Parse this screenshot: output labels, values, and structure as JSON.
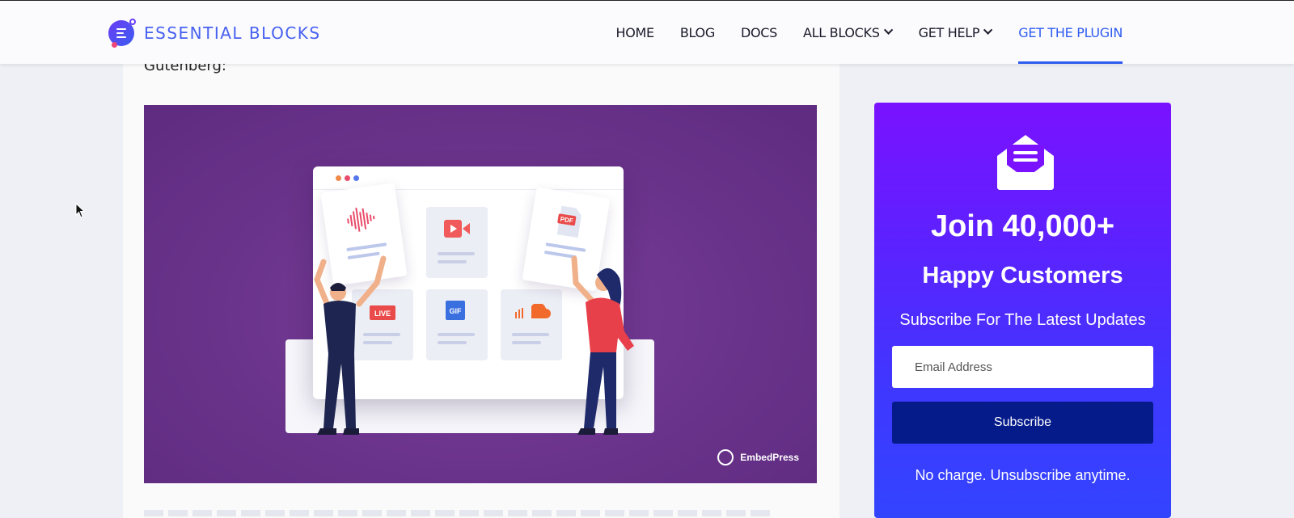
{
  "header": {
    "logo_text": "ESSENTIAL BLOCKS",
    "nav": [
      {
        "label": "HOME"
      },
      {
        "label": "BLOG"
      },
      {
        "label": "DOCS"
      },
      {
        "label": "ALL BLOCKS",
        "dropdown": true
      },
      {
        "label": "GET HELP",
        "dropdown": true
      },
      {
        "label": "GET THE PLUGIN",
        "active": true
      }
    ]
  },
  "article": {
    "intro_text": "Gutenberg:",
    "figure": {
      "tiles": [
        "LIVE",
        "GIF"
      ],
      "pdf_label": "PDF",
      "brand": "EmbedPress"
    }
  },
  "sidebar": {
    "title": "Join 40,000+",
    "subtitle": "Happy Customers",
    "tagline": "Subscribe For The Latest Updates",
    "email_placeholder": "Email Address",
    "subscribe_label": "Subscribe",
    "footnote": "No charge. Unsubscribe anytime."
  },
  "colors": {
    "accent": "#2f5cf0",
    "figure_bg": "#6a338b",
    "sidebar_top": "#7a12ff",
    "sidebar_bottom": "#3344ff",
    "button": "#061b8a"
  }
}
